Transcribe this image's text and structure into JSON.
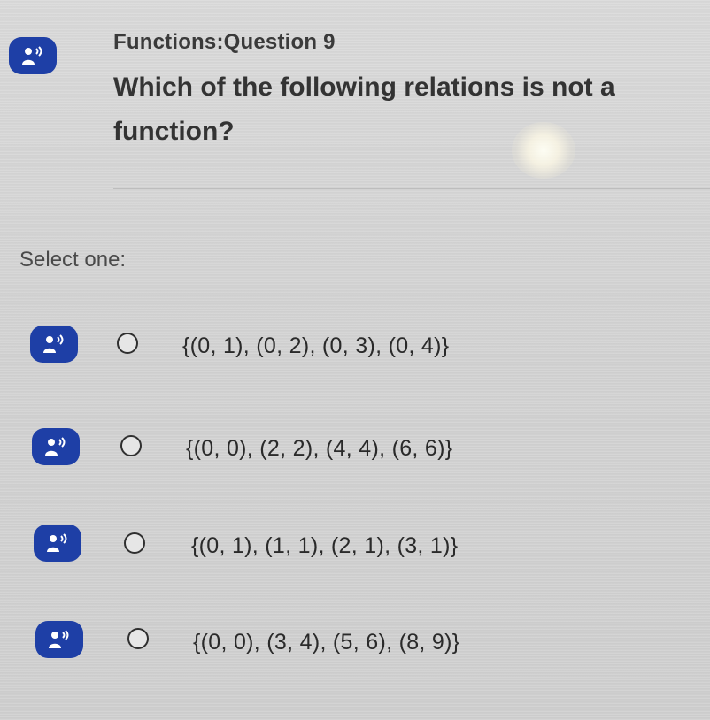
{
  "quiz": {
    "title": "Functions:Question 9",
    "question": "Which of the following relations is not a function?",
    "select_label": "Select one:",
    "options": [
      {
        "text": "{(0, 1), (0, 2), (0, 3), (0, 4)}"
      },
      {
        "text": "{(0, 0), (2, 2), (4, 4), (6, 6)}"
      },
      {
        "text": "{(0, 1), (1, 1), (2, 1), (3, 1)}"
      },
      {
        "text": "{(0, 0), (3, 4), (5, 6), (8, 9)}"
      }
    ]
  },
  "icons": {
    "audio": "speaker-person-icon"
  },
  "colors": {
    "audio_button": "#1e3fa6",
    "background": "#d4d4d4"
  }
}
